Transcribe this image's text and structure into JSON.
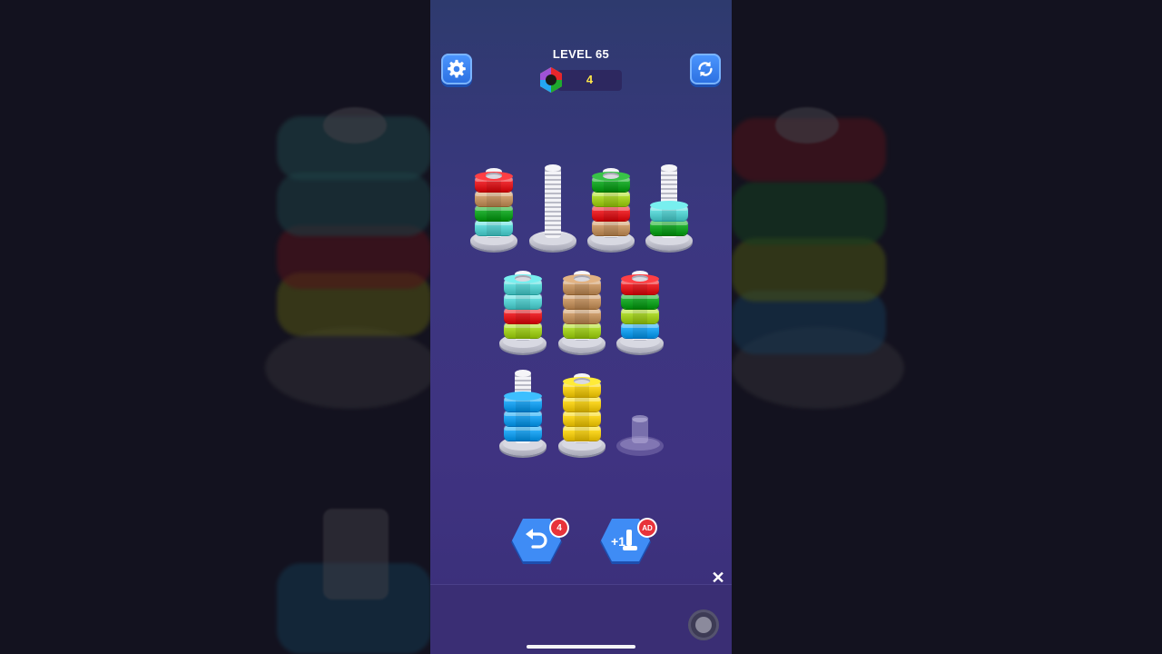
{
  "header": {
    "level_title": "LEVEL 65",
    "coins": "4"
  },
  "buttons": {
    "settings": "settings",
    "restart": "restart",
    "undo_badge": "4",
    "add_bolt_badge": "AD"
  },
  "colors": {
    "red": "#e8262b",
    "tan": "#c99a6a",
    "green": "#1faa2e",
    "cyan": "#5fd6d6",
    "lime": "#a9d52b",
    "blue": "#24a6f2",
    "yellow": "#f7d21f"
  },
  "bolts": [
    {
      "row": 1,
      "col": 1,
      "nuts": [
        "cyan",
        "green",
        "tan",
        "red"
      ]
    },
    {
      "row": 1,
      "col": 2,
      "nuts": []
    },
    {
      "row": 1,
      "col": 3,
      "nuts": [
        "tan",
        "red",
        "lime",
        "green"
      ]
    },
    {
      "row": 1,
      "col": 4,
      "nuts": [
        "green",
        "cyan"
      ]
    },
    {
      "row": 2,
      "col": 1,
      "nuts": [
        "lime",
        "red",
        "cyan",
        "cyan"
      ]
    },
    {
      "row": 2,
      "col": 2,
      "nuts": [
        "lime",
        "tan",
        "tan",
        "tan"
      ]
    },
    {
      "row": 2,
      "col": 3,
      "nuts": [
        "blue",
        "lime",
        "green",
        "red"
      ]
    },
    {
      "row": 3,
      "col": 1,
      "nuts": [
        "blue",
        "blue",
        "blue"
      ]
    },
    {
      "row": 3,
      "col": 2,
      "nuts": [
        "yellow",
        "yellow",
        "yellow",
        "yellow"
      ]
    },
    {
      "row": 3,
      "col": 3,
      "nuts": [],
      "placeholder": true
    }
  ],
  "icons": {
    "settings": "gear-icon",
    "restart": "refresh-icon",
    "coin": "hex-coin-icon",
    "undo": "undo-icon",
    "add_bolt": "add-bolt-icon",
    "close": "close-icon"
  }
}
